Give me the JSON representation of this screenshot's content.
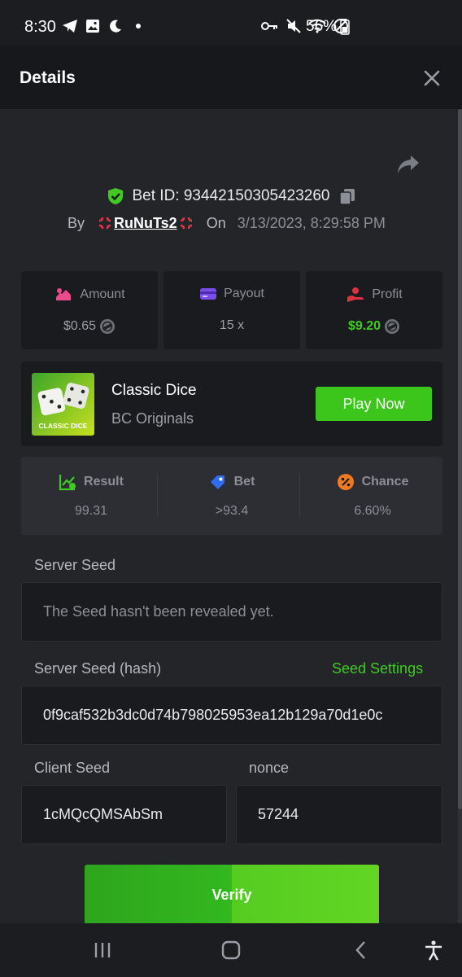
{
  "status_bar": {
    "time": "8:30",
    "battery": "56%",
    "left_icons": [
      "telegram-icon",
      "gallery-icon",
      "moon-icon",
      "dot-icon"
    ],
    "right_icons": [
      "key-icon",
      "mute-icon",
      "wifi-icon",
      "block-icon",
      "battery-icon"
    ]
  },
  "header": {
    "title": "Details"
  },
  "bet": {
    "id_text": "Bet ID: 93442150305423260",
    "by_label": "By",
    "user": "RuNuTs2",
    "on_label": "On",
    "date": "3/13/2023, 8:29:58 PM"
  },
  "stats": {
    "amount": {
      "label": "Amount",
      "value": "$0.65"
    },
    "payout": {
      "label": "Payout",
      "value": "15 x"
    },
    "profit": {
      "label": "Profit",
      "value": "$9.20"
    }
  },
  "game": {
    "name": "Classic Dice",
    "provider": "BC Originals",
    "thumb_label": "CLASSIC DICE",
    "play_label": "Play Now"
  },
  "result": {
    "result": {
      "label": "Result",
      "value": "99.31"
    },
    "bet": {
      "label": "Bet",
      "value": ">93.4"
    },
    "chance": {
      "label": "Chance",
      "value": "6.60%"
    }
  },
  "seeds": {
    "server_seed_label": "Server Seed",
    "server_seed_value": "The Seed hasn't been revealed yet.",
    "server_hash_label": "Server Seed (hash)",
    "seed_settings_label": "Seed Settings",
    "server_hash_value": "0f9caf532b3dc0d74b798025953ea12b129a70d1e0c",
    "client_seed_label": "Client Seed",
    "client_seed_value": "1cMQcQMSAbSm",
    "nonce_label": "nonce",
    "nonce_value": "57244"
  },
  "verify_label": "Verify",
  "colors": {
    "accent_green": "#3cc61c",
    "background": "#232529",
    "card": "#1a1b1f"
  }
}
